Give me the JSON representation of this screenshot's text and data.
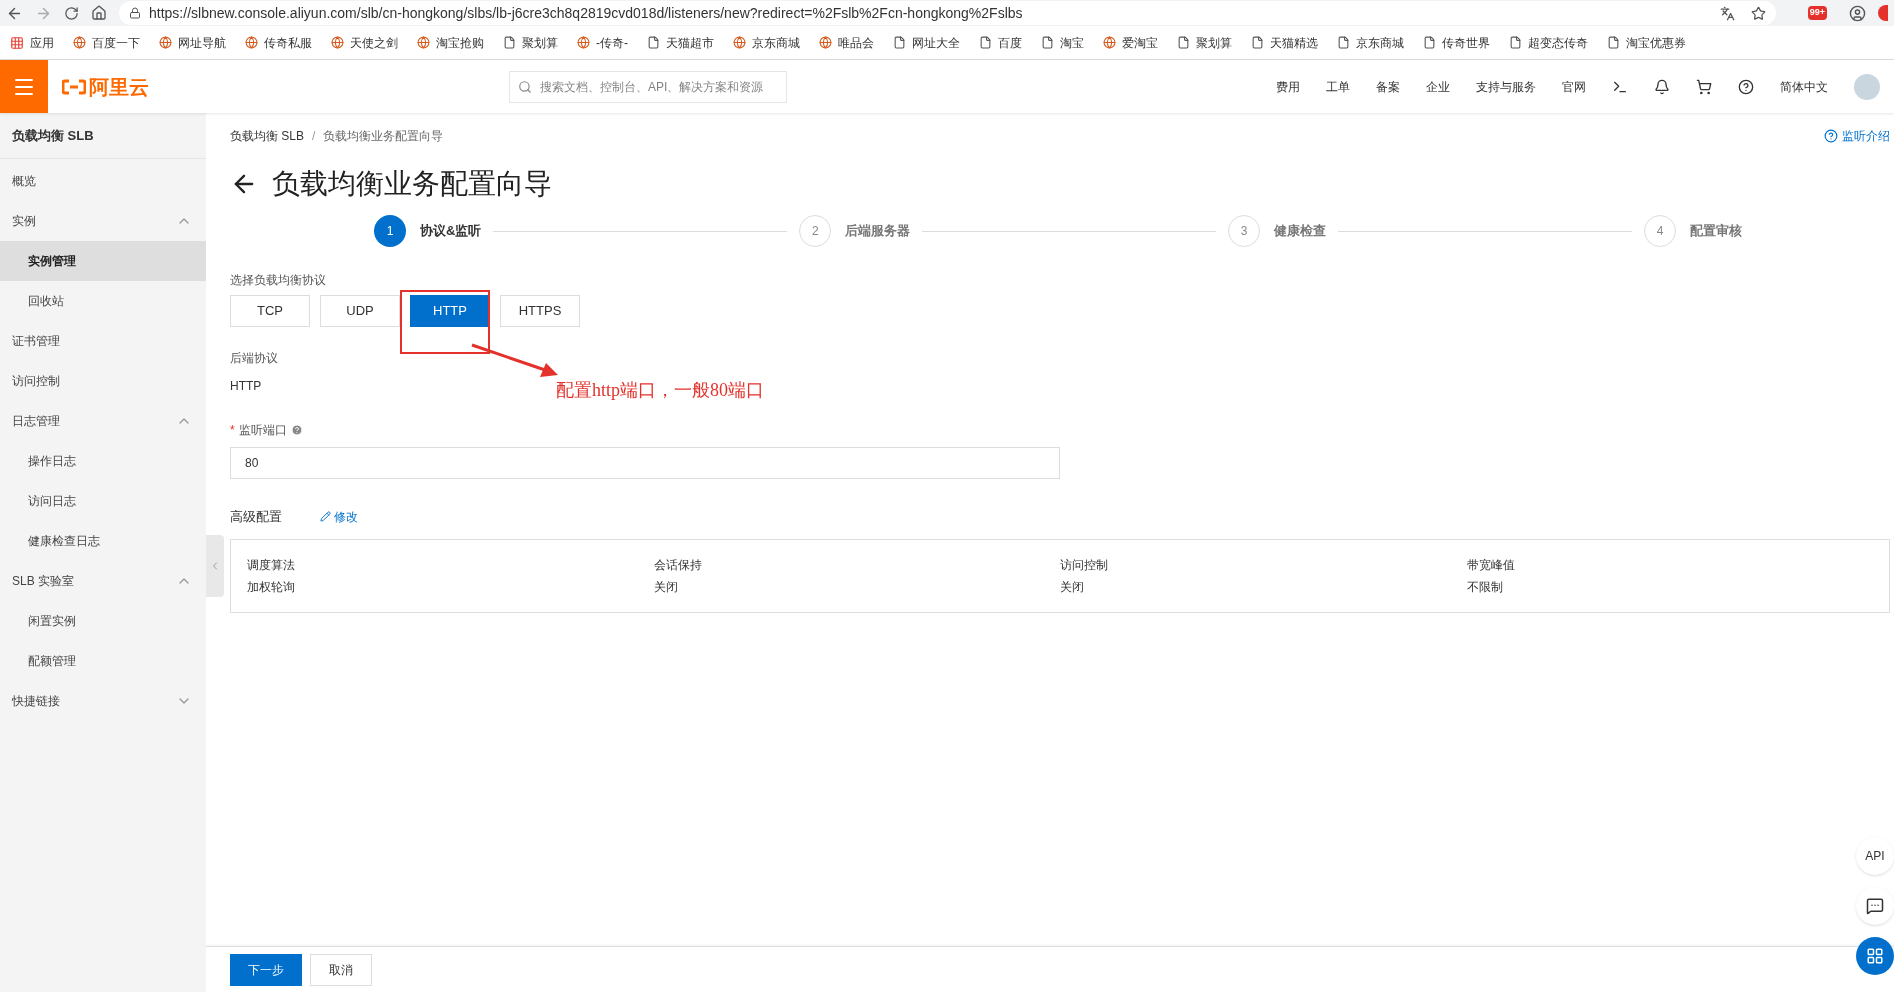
{
  "browser": {
    "url": "https://slbnew.console.aliyun.com/slb/cn-hongkong/slbs/lb-j6cre3ch8q2819cvd018d/listeners/new?redirect=%2Fslb%2Fcn-hongkong%2Fslbs",
    "notification_badge": "99+",
    "bookmarks": [
      {
        "label": "应用",
        "kind": "apps"
      },
      {
        "label": "百度一下",
        "kind": "site"
      },
      {
        "label": "网址导航",
        "kind": "site"
      },
      {
        "label": "传奇私服",
        "kind": "site"
      },
      {
        "label": "天使之剑",
        "kind": "site"
      },
      {
        "label": "淘宝抢购",
        "kind": "site"
      },
      {
        "label": "聚划算",
        "kind": "page"
      },
      {
        "label": "-传奇-",
        "kind": "site"
      },
      {
        "label": "天猫超市",
        "kind": "page"
      },
      {
        "label": "京东商城",
        "kind": "site"
      },
      {
        "label": "唯品会",
        "kind": "site"
      },
      {
        "label": "网址大全",
        "kind": "page"
      },
      {
        "label": "百度",
        "kind": "page"
      },
      {
        "label": "淘宝",
        "kind": "page"
      },
      {
        "label": "爱淘宝",
        "kind": "site"
      },
      {
        "label": "聚划算",
        "kind": "page"
      },
      {
        "label": "天猫精选",
        "kind": "page"
      },
      {
        "label": "京东商城",
        "kind": "page"
      },
      {
        "label": "传奇世界",
        "kind": "page"
      },
      {
        "label": "超变态传奇",
        "kind": "page"
      },
      {
        "label": "淘宝优惠券",
        "kind": "page"
      }
    ]
  },
  "header": {
    "logo": "阿里云",
    "search": {
      "placeholder": "搜索文档、控制台、API、解决方案和资源"
    },
    "nav": [
      "费用",
      "工单",
      "备案",
      "企业",
      "支持与服务",
      "官网"
    ],
    "language": "简体中文"
  },
  "sidebar": {
    "title": "负载均衡 SLB",
    "items": [
      {
        "label": "概览"
      },
      {
        "label": "实例",
        "expanded": true,
        "children": [
          {
            "label": "实例管理",
            "selected": true
          },
          {
            "label": "回收站",
            "selected": false
          }
        ]
      },
      {
        "label": "证书管理"
      },
      {
        "label": "访问控制"
      },
      {
        "label": "日志管理",
        "expanded": true,
        "children": [
          {
            "label": "操作日志",
            "selected": false
          },
          {
            "label": "访问日志",
            "selected": false
          },
          {
            "label": "健康检查日志",
            "selected": false
          }
        ]
      },
      {
        "label": "SLB 实验室",
        "expanded": true,
        "children": [
          {
            "label": "闲置实例",
            "selected": false
          },
          {
            "label": "配额管理",
            "selected": false
          }
        ]
      },
      {
        "label": "快捷链接",
        "expanded": false
      }
    ]
  },
  "breadcrumb": [
    "负载均衡 SLB",
    "/",
    "负载均衡业务配置向导"
  ],
  "help_link": "监听介绍",
  "page_title": "负载均衡业务配置向导",
  "steps": [
    {
      "number": "1",
      "label": "协议&监听",
      "selected": true
    },
    {
      "number": "2",
      "label": "后端服务器",
      "selected": false
    },
    {
      "number": "3",
      "label": "健康检查",
      "selected": false
    },
    {
      "number": "4",
      "label": "配置审核",
      "selected": false
    }
  ],
  "protocol": {
    "label": "选择负载均衡协议",
    "options": [
      {
        "label": "TCP",
        "selected": false
      },
      {
        "label": "UDP",
        "selected": false
      },
      {
        "label": "HTTP",
        "selected": true
      },
      {
        "label": "HTTPS",
        "selected": false
      }
    ]
  },
  "backend_protocol": {
    "label": "后端协议",
    "value": "HTTP"
  },
  "port": {
    "label": "监听端口",
    "required_mark": "*",
    "value": "80"
  },
  "annotation": "配置http端口，一般80端口",
  "advanced": {
    "title": "高级配置",
    "edit": "修改",
    "fields": [
      {
        "label": "调度算法",
        "value": "加权轮询"
      },
      {
        "label": "会话保持",
        "value": "关闭"
      },
      {
        "label": "访问控制",
        "value": "关闭"
      },
      {
        "label": "带宽峰值",
        "value": "不限制"
      }
    ]
  },
  "floating": {
    "api": "API"
  },
  "footer": [
    "下一步",
    "取消"
  ]
}
